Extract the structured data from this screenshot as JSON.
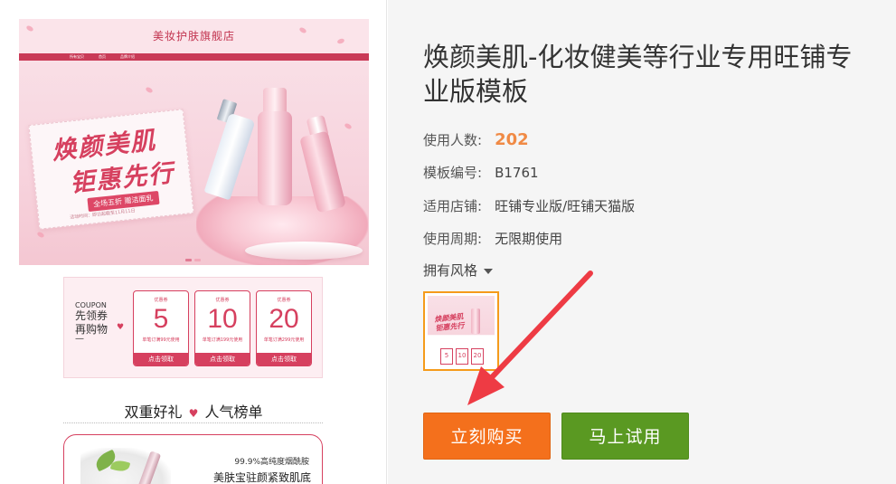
{
  "preview": {
    "shop_name": "美妆护肤旗舰店",
    "nav": [
      "所有宝贝",
      "首页",
      "品牌介绍"
    ],
    "banner": {
      "title_line1": "焕颜美肌",
      "title_line2": "钜惠先行",
      "tag": "全场五折 赠洁面乳",
      "time": "活动时间：即日起截至11月11日"
    },
    "coupon_intro": {
      "en": "COUPON",
      "line1": "先领券",
      "line2": "再购物",
      "dash": "—"
    },
    "coupons": [
      {
        "label": "优惠券",
        "value": "5",
        "condition": "单笔订满99元使用",
        "button": "点击领取"
      },
      {
        "label": "优惠券",
        "value": "10",
        "condition": "单笔订满199元使用",
        "button": "点击领取"
      },
      {
        "label": "优惠券",
        "value": "20",
        "condition": "单笔订满299元使用",
        "button": "点击领取"
      }
    ],
    "gift_section": {
      "left": "双重好礼",
      "heart": "♥",
      "right": "人气榜单"
    },
    "product": {
      "tagline": "99.9%高纯度烟酰胺",
      "name": "美肤宝驻颜紧致肌底"
    }
  },
  "info": {
    "title": "焕颜美肌-化妆健美等行业专用旺铺专业版模板",
    "rows": [
      {
        "label": "使用人数:",
        "value": "202"
      },
      {
        "label": "模板编号:",
        "value": "B1761"
      },
      {
        "label": "适用店铺:",
        "value": "旺铺专业版/旺铺天猫版"
      },
      {
        "label": "使用周期:",
        "value": "无限期使用"
      }
    ],
    "style_toggle": "拥有风格",
    "thumb": {
      "title_line1": "焕颜美肌",
      "title_line2": "钜惠先行",
      "coupons": [
        "5",
        "10",
        "20"
      ]
    },
    "buy_button": "立刻购买",
    "trial_button": "马上试用",
    "colors": {
      "accent_orange": "#f4701c",
      "accent_green": "#5a9922",
      "usage_count": "#f08a45",
      "arrow": "#ee3b44",
      "brand_pink": "#d6405f"
    }
  }
}
